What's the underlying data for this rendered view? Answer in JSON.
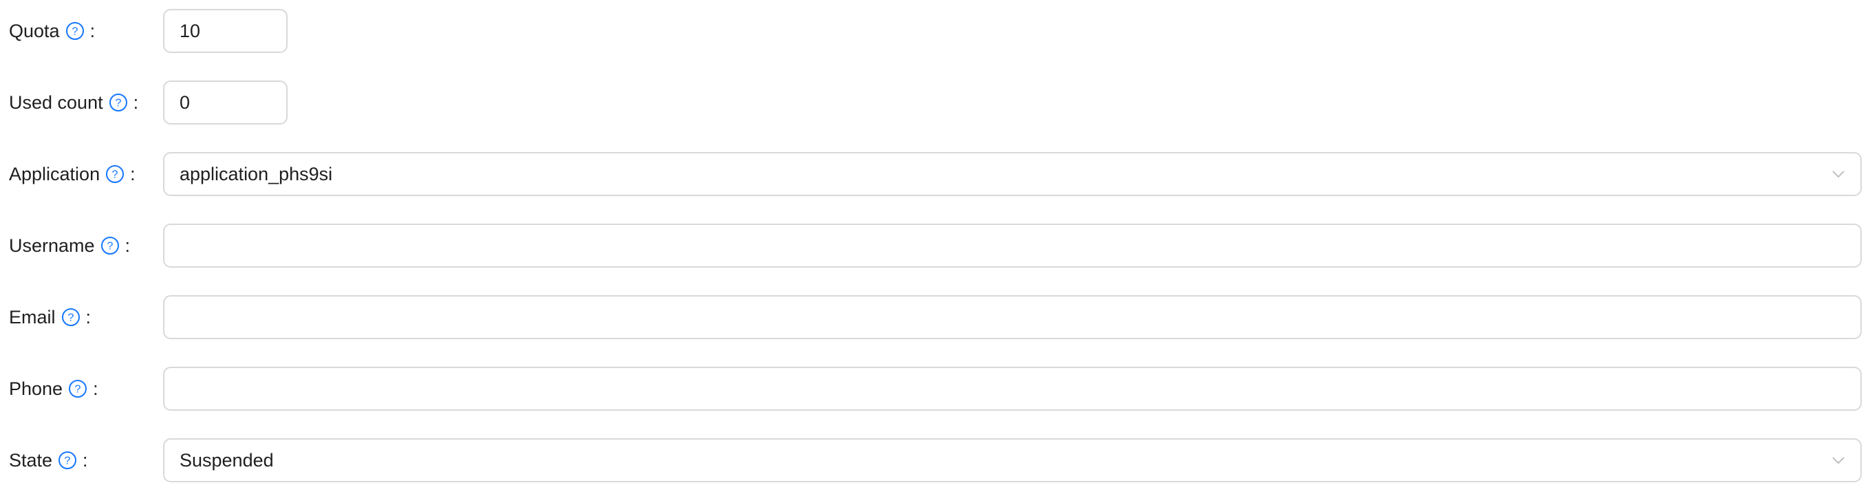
{
  "form": {
    "quota": {
      "label": "Quota",
      "value": "10"
    },
    "used_count": {
      "label": "Used count",
      "value": "0"
    },
    "application": {
      "label": "Application",
      "value": "application_phs9si"
    },
    "username": {
      "label": "Username",
      "value": ""
    },
    "email": {
      "label": "Email",
      "value": ""
    },
    "phone": {
      "label": "Phone",
      "value": ""
    },
    "state": {
      "label": "State",
      "value": "Suspended"
    },
    "colon": ":"
  },
  "icons": {
    "help": "question-circle-icon",
    "dropdown": "chevron-down-icon"
  },
  "colors": {
    "help_icon": "#1677ff",
    "border": "#d9d9d9",
    "chevron": "#bfbfbf"
  }
}
